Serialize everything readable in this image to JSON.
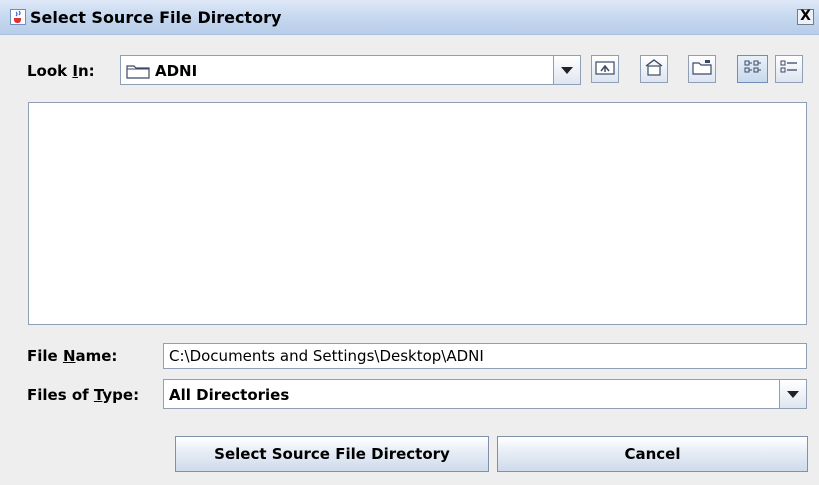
{
  "window": {
    "title": "Select Source File Directory",
    "close_label": "X"
  },
  "look_in": {
    "label_prefix": "Look ",
    "label_mnemonic": "I",
    "label_suffix": "n:",
    "selected": "ADNI"
  },
  "toolbar": {
    "icons": [
      "up-one-level-icon",
      "home-icon",
      "new-folder-icon",
      "list-view-icon",
      "details-view-icon"
    ]
  },
  "file_name": {
    "label_prefix": "File ",
    "label_mnemonic": "N",
    "label_suffix": "ame:",
    "value": "C:\\Documents and Settings\\Desktop\\ADNI"
  },
  "files_of_type": {
    "label_prefix": "Files of ",
    "label_mnemonic": "T",
    "label_suffix": "ype:",
    "selected": "All Directories"
  },
  "buttons": {
    "approve_label": "Select Source File Directory",
    "cancel_label": "Cancel"
  },
  "colors": {
    "title_bar": "#c6d8f0",
    "background": "#eeeeee",
    "border": "#8e9fb6"
  }
}
